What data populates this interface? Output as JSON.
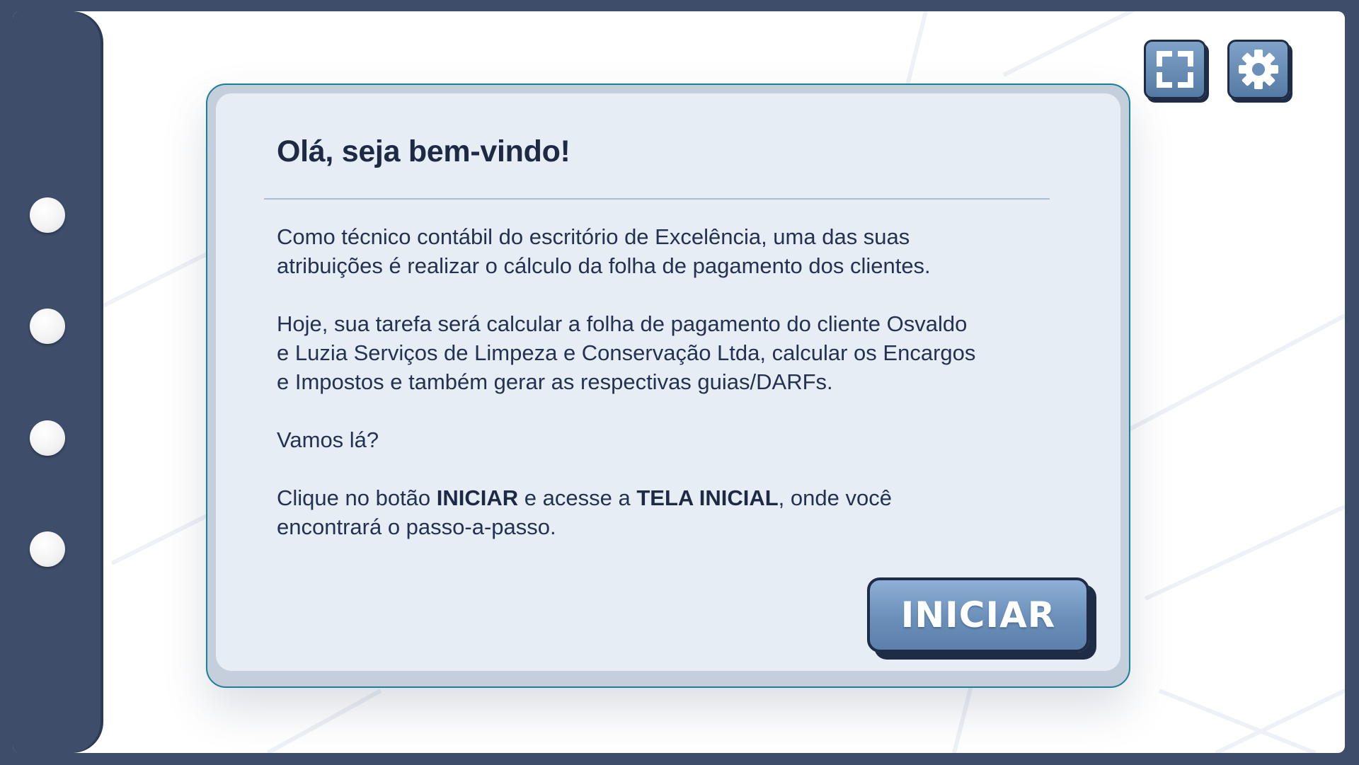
{
  "toolbar": {
    "fullscreen_icon": "fullscreen-icon",
    "settings_icon": "gear-icon"
  },
  "dialog": {
    "title": "Olá, seja bem-vindo!",
    "paragraph1_line1": "Como técnico contábil do escritório de Excelência, uma das suas",
    "paragraph1_line2": "atribuições é realizar o cálculo da folha de pagamento dos clientes.",
    "paragraph2_line1": "Hoje, sua tarefa será calcular a folha de pagamento do cliente Osvaldo",
    "paragraph2_line2": "e Luzia Serviços de Limpeza e Conservação Ltda, calcular os Encargos",
    "paragraph2_line3": "e Impostos e também gerar as respectivas guias/DARFs.",
    "paragraph3": "Vamos lá?",
    "paragraph4_pre": "Clique no botão ",
    "paragraph4_bold1": "INICIAR",
    "paragraph4_mid": " e acesse a ",
    "paragraph4_bold2": "TELA INICIAL",
    "paragraph4_post": ", onde você",
    "paragraph4_line2": "encontrará o passo-a-passo.",
    "start_label": "INICIAR"
  },
  "colors": {
    "frame": "#3d4d6a",
    "card_border": "#1b7f99",
    "card_bg": "#e7edf4",
    "title": "#1e2a44",
    "button": "#6a8fb9"
  }
}
